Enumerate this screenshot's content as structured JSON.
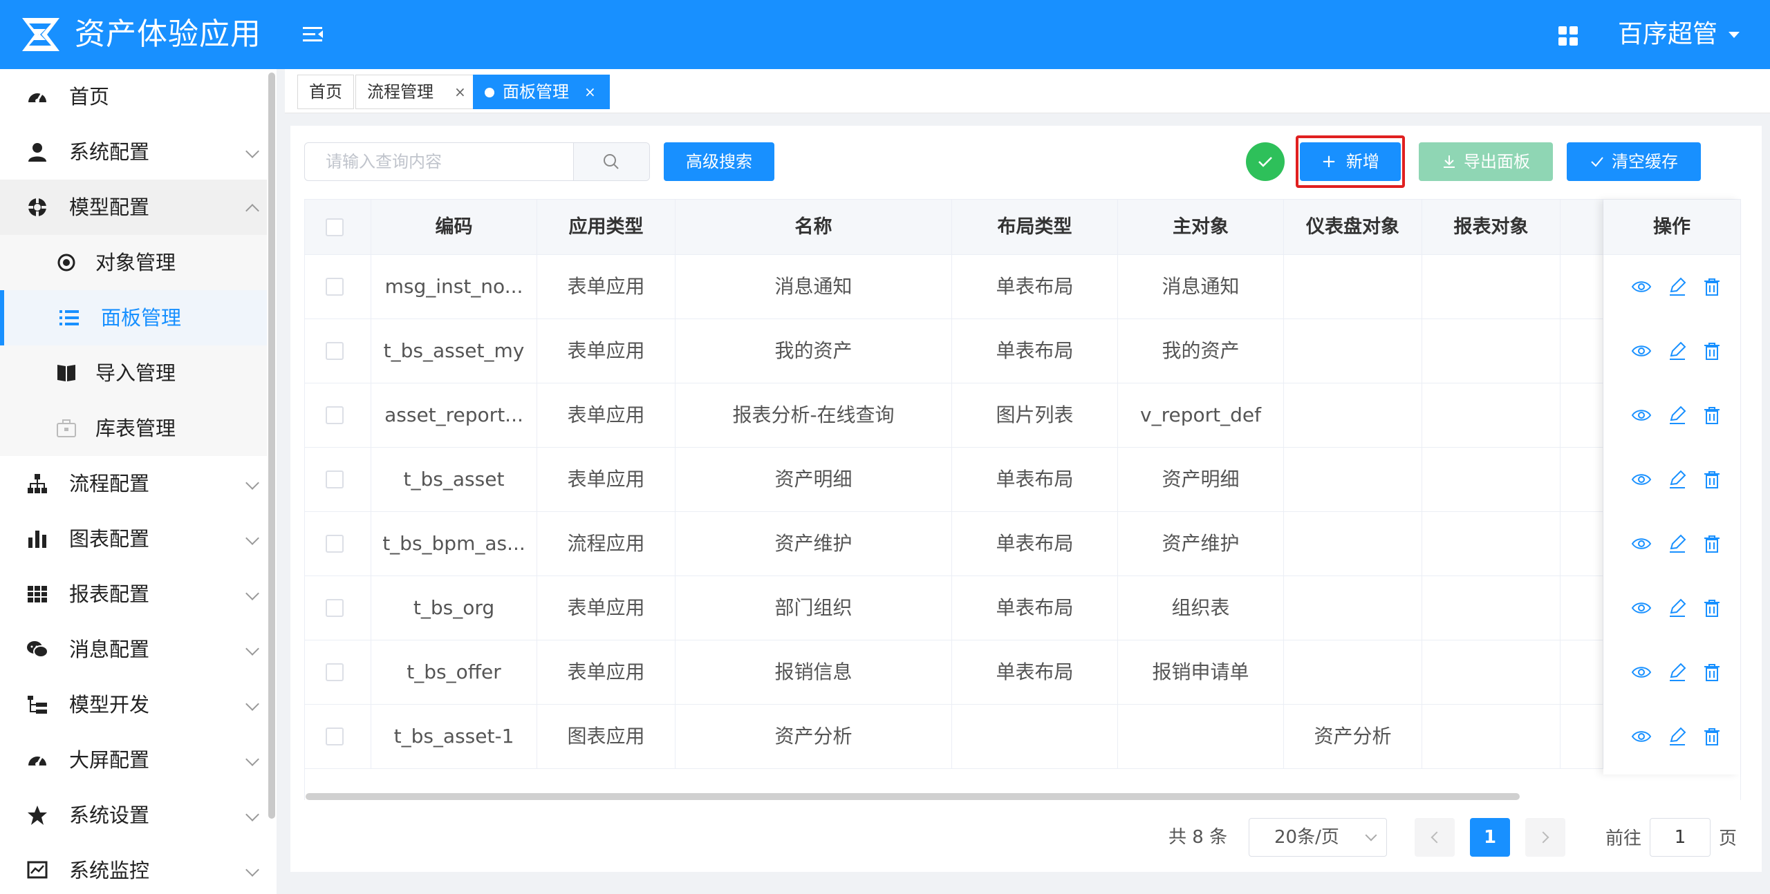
{
  "app": {
    "title": "资产体验应用",
    "user": "百序超管"
  },
  "sidebar": {
    "items": [
      {
        "label": "首页",
        "icon": "dashboard-icon"
      },
      {
        "label": "系统配置",
        "icon": "user-icon"
      },
      {
        "label": "模型配置",
        "icon": "model-icon",
        "expanded": true
      },
      {
        "label": "对象管理",
        "icon": "target-icon"
      },
      {
        "label": "面板管理",
        "icon": "list-icon",
        "active": true
      },
      {
        "label": "导入管理",
        "icon": "book-icon"
      },
      {
        "label": "库表管理",
        "icon": "briefcase-icon"
      },
      {
        "label": "流程配置",
        "icon": "sitemap-icon"
      },
      {
        "label": "图表配置",
        "icon": "bar-chart-icon"
      },
      {
        "label": "报表配置",
        "icon": "table-icon"
      },
      {
        "label": "消息配置",
        "icon": "chat-icon"
      },
      {
        "label": "模型开发",
        "icon": "tree-icon"
      },
      {
        "label": "大屏配置",
        "icon": "dashboard-icon"
      },
      {
        "label": "系统设置",
        "icon": "star-icon"
      },
      {
        "label": "系统监控",
        "icon": "monitor-icon"
      }
    ]
  },
  "tabs": [
    {
      "label": "首页"
    },
    {
      "label": "流程管理",
      "close": "×"
    },
    {
      "label": "面板管理",
      "close": "×",
      "active": true
    }
  ],
  "toolbar": {
    "search_placeholder": "请输入查询内容",
    "search_value": "",
    "advanced_search": "高级搜索",
    "add": "新增",
    "export": "导出面板",
    "clear_cache": "清空缓存"
  },
  "table": {
    "columns": [
      "编码",
      "应用类型",
      "名称",
      "布局类型",
      "主对象",
      "仪表盘对象",
      "报表对象",
      "操作"
    ],
    "rows": [
      [
        "msg_inst_no...",
        "表单应用",
        "消息通知",
        "单表布局",
        "消息通知",
        "",
        ""
      ],
      [
        "t_bs_asset_my",
        "表单应用",
        "我的资产",
        "单表布局",
        "我的资产",
        "",
        ""
      ],
      [
        "asset_report...",
        "表单应用",
        "报表分析-在线查询",
        "图片列表",
        "v_report_def",
        "",
        ""
      ],
      [
        "t_bs_asset",
        "表单应用",
        "资产明细",
        "单表布局",
        "资产明细",
        "",
        ""
      ],
      [
        "t_bs_bpm_as...",
        "流程应用",
        "资产维护",
        "单表布局",
        "资产维护",
        "",
        ""
      ],
      [
        "t_bs_org",
        "表单应用",
        "部门组织",
        "单表布局",
        "组织表",
        "",
        ""
      ],
      [
        "t_bs_offer",
        "表单应用",
        "报销信息",
        "单表布局",
        "报销申请单",
        "",
        ""
      ],
      [
        "t_bs_asset-1",
        "图表应用",
        "资产分析",
        "",
        "",
        "资产分析",
        ""
      ]
    ]
  },
  "pagination": {
    "total": "共 8 条",
    "page_size": "20条/页",
    "current": "1",
    "goto_label": "前往",
    "goto_value": "1",
    "page_suffix": "页"
  },
  "colors": {
    "primary": "#1890ff",
    "success": "#2ec05a",
    "export": "#8fd6b4",
    "highlight": "#e02020"
  }
}
